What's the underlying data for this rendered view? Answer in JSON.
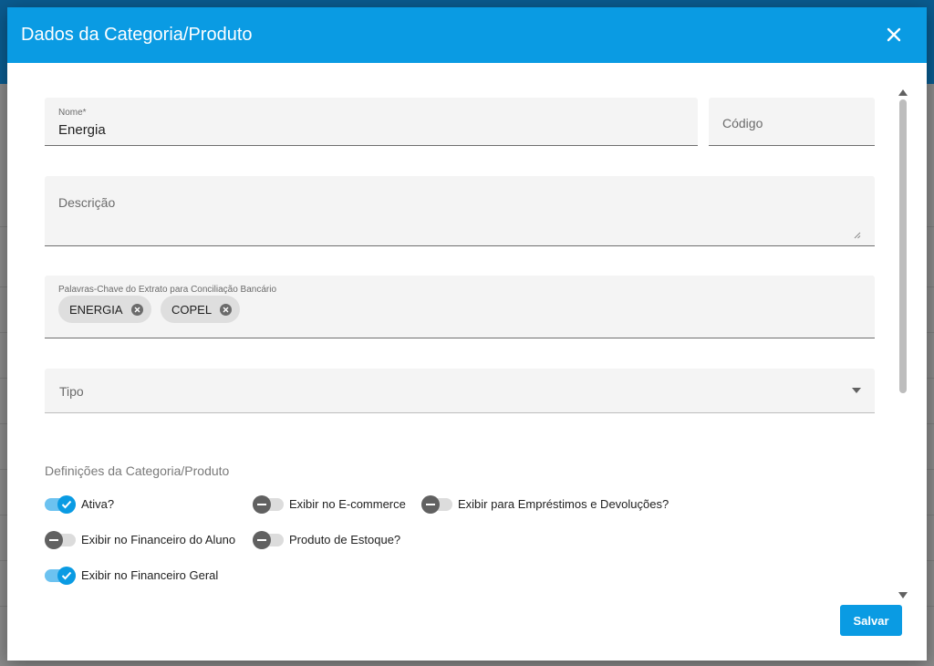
{
  "dialog": {
    "title": "Dados da Categoria/Produto"
  },
  "form": {
    "nome": {
      "label": "Nome*",
      "value": "Energia"
    },
    "codigo": {
      "placeholder": "Código"
    },
    "descricao": {
      "placeholder": "Descrição"
    },
    "keywords": {
      "label": "Palavras-Chave do Extrato para Conciliação Bancário",
      "chips": [
        "ENERGIA",
        "COPEL"
      ]
    },
    "tipo": {
      "placeholder": "Tipo"
    }
  },
  "definitions": {
    "title": "Definições da Categoria/Produto",
    "toggles": [
      {
        "label": "Ativa?",
        "checked": true
      },
      {
        "label": "Exibir no E-commerce",
        "checked": false
      },
      {
        "label": "Exibir para Empréstimos e Devoluções?",
        "checked": false
      },
      {
        "label": "Exibir no Financeiro do Aluno",
        "checked": false
      },
      {
        "label": "Produto de Estoque?",
        "checked": false
      },
      {
        "label": "Exibir no Financeiro Geral",
        "checked": true
      }
    ]
  },
  "actions": {
    "save_label": "Salvar"
  },
  "colors": {
    "primary": "#0a9be3",
    "track_on": "#6cc2f0",
    "thumb_off": "#616161"
  },
  "icons": [
    "close-icon",
    "chip-remove-icon",
    "dropdown-arrow-icon",
    "check-icon",
    "resize-handle-icon",
    "scroll-up-icon",
    "scroll-down-icon"
  ]
}
